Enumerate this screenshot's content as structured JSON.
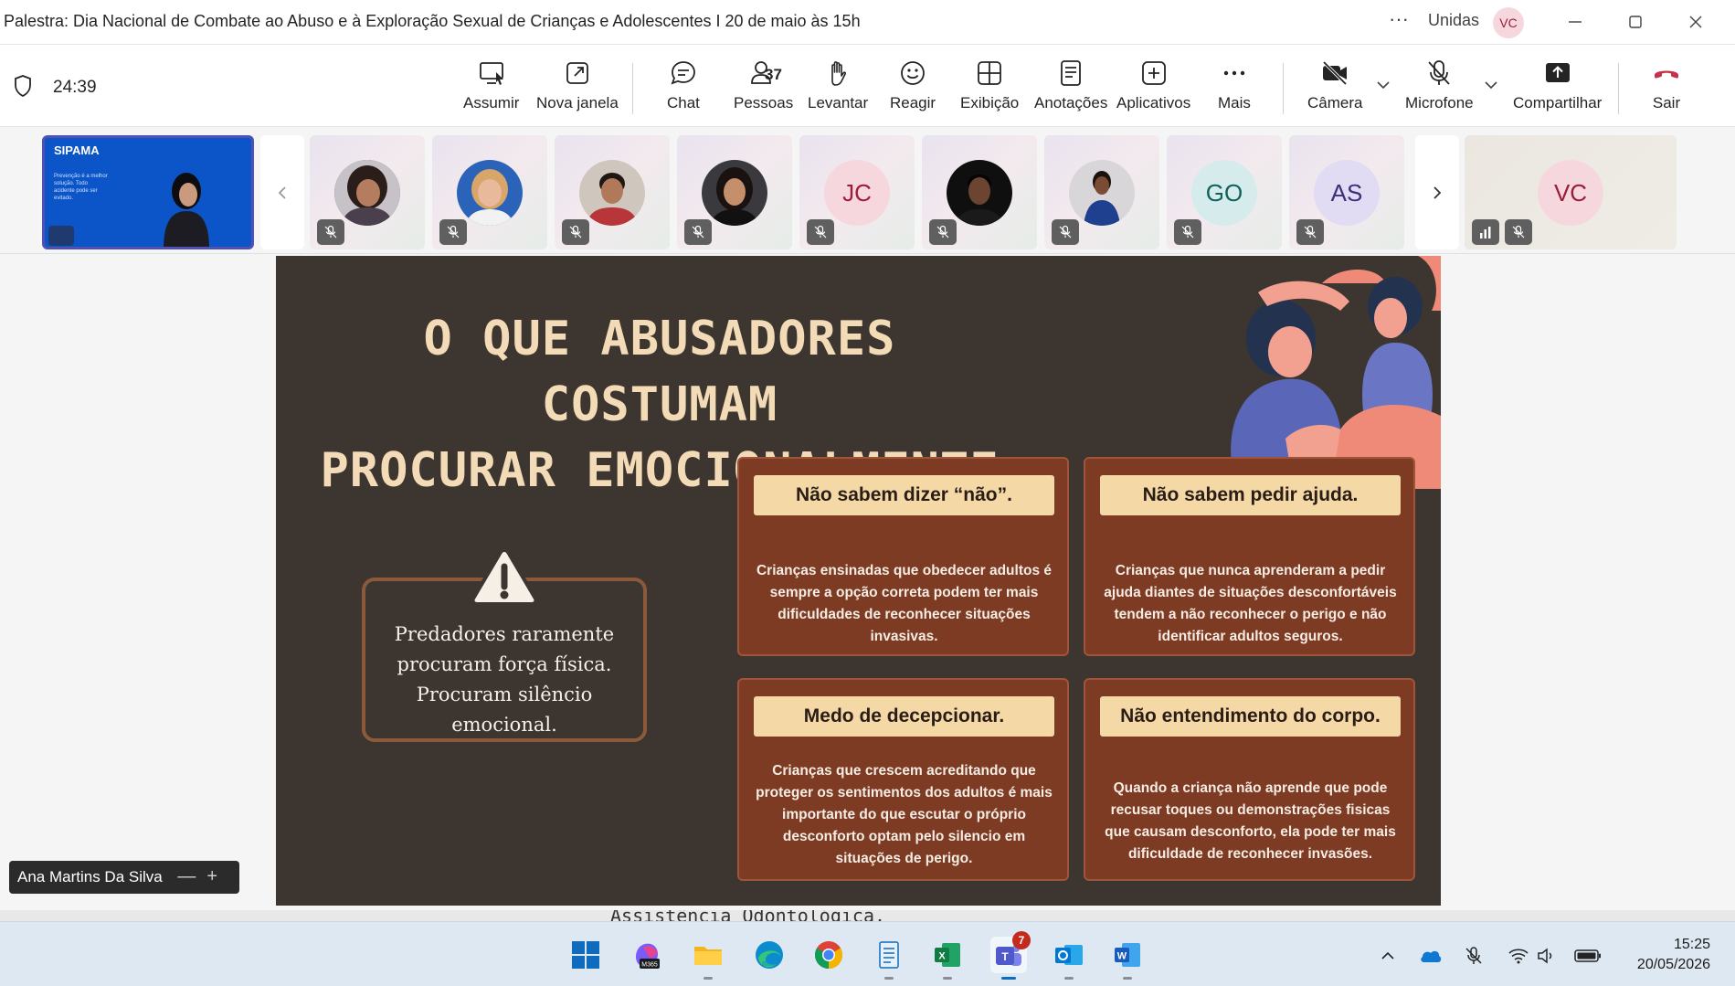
{
  "window": {
    "title": "Palestra: Dia Nacional de Combate ao Abuso e à Exploração Sexual de Crianças e Adolescentes I 20 de maio às 15h",
    "more": "···",
    "org_label": "Unidas",
    "org_avatar": "VC"
  },
  "meeting": {
    "timer": "24:39",
    "toolbar": {
      "assumir": "Assumir",
      "nova_janela": "Nova janela",
      "chat": "Chat",
      "pessoas": "Pessoas",
      "pessoas_count": "37",
      "levantar": "Levantar",
      "reagir": "Reagir",
      "exibicao": "Exibição",
      "anotacoes": "Anotações",
      "aplicativos": "Aplicativos",
      "mais": "Mais",
      "camera": "Câmera",
      "microfone": "Microfone",
      "compartilhar": "Compartilhar",
      "sair": "Sair"
    },
    "share_thumb": {
      "brand": "SIPAMA",
      "subtitle": "Prevenção é a melhor solução. Todo acidente pode ser evitado."
    },
    "participants": [
      {
        "type": "photo",
        "muted": true
      },
      {
        "type": "photo",
        "muted": true
      },
      {
        "type": "photo",
        "muted": true
      },
      {
        "type": "photo",
        "muted": true
      },
      {
        "type": "initials",
        "initials": "JC",
        "muted": true
      },
      {
        "type": "photo",
        "muted": true
      },
      {
        "type": "photo",
        "muted": true
      },
      {
        "type": "initials",
        "initials": "GO",
        "muted": true
      },
      {
        "type": "initials",
        "initials": "AS",
        "muted": true
      }
    ],
    "self_tile": {
      "initials": "VC"
    },
    "presenter_name": "Ana Martins Da Silva"
  },
  "slide": {
    "title_line1": "O QUE ABUSADORES COSTUMAM",
    "title_line2": "PROCURAR EMOCIONALMENTE",
    "warning_text": "Predadores raramente procuram força física. Procuram silêncio emocional.",
    "cards": [
      {
        "heading": "Não sabem dizer “não”.",
        "text": "Crianças ensinadas que obedecer adultos é sempre a opção correta podem ter mais dificuldades de reconhecer situações invasivas."
      },
      {
        "heading": "Não sabem pedir ajuda.",
        "text": "Crianças que nunca aprenderam a pedir ajuda diantes de situações desconfortáveis tendem a não reconhecer o perigo e não identificar adultos seguros."
      },
      {
        "heading": "Medo de decepcionar.",
        "text": "Crianças que crescem acreditando que proteger os sentimentos dos adultos é mais importante do que escutar o próprio desconforto optam pelo silencio em situações de perigo."
      },
      {
        "heading": "Não entendimento do corpo.",
        "text": "Quando a criança não aprende que pode recusar toques ou demonstrações fisicas que causam desconforto, ela pode ter mais dificuldade de reconhecer invasões."
      }
    ]
  },
  "background_doc": {
    "visible_text": "Assistência Odontológica."
  },
  "taskbar": {
    "teams_badge": "7",
    "time": "15:25",
    "date": "20/05/2026"
  },
  "colors": {
    "slide_bg": "#3d3530",
    "card_bg": "#7c3b22",
    "card_head": "#f4d8a6",
    "title_color": "#f2dbb6",
    "accent": "#4f52b2",
    "leave": "#c4314b"
  }
}
